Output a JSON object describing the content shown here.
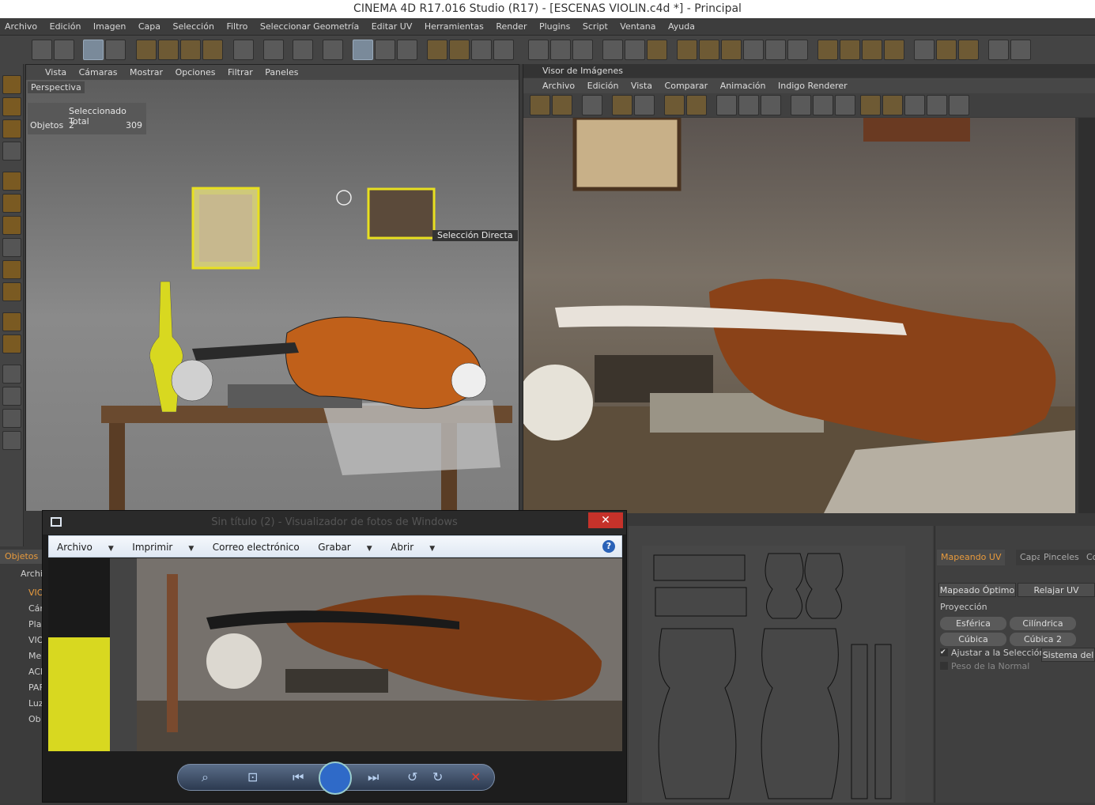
{
  "window": {
    "title": "CINEMA 4D R17.016 Studio (R17) - [ESCENAS VIOLIN.c4d *] - Principal"
  },
  "menu": [
    "Archivo",
    "Edición",
    "Imagen",
    "Capa",
    "Selección",
    "Filtro",
    "Seleccionar Geometría",
    "Editar UV",
    "Herramientas",
    "Render",
    "Plugins",
    "Script",
    "Ventana",
    "Ayuda"
  ],
  "viewport": {
    "menu": [
      "Vista",
      "Cámaras",
      "Mostrar",
      "Opciones",
      "Filtrar",
      "Paneles"
    ],
    "label": "Perspectiva",
    "stats": {
      "col_selected": "Seleccionado Total",
      "row_label": "Objetos",
      "selected": "2",
      "total": "309"
    },
    "tool_label": "Selección Directa"
  },
  "render_viewer": {
    "title": "Visor de Imágenes",
    "menu": [
      "Archivo",
      "Edición",
      "Vista",
      "Comparar",
      "Animación",
      "Indigo Renderer"
    ]
  },
  "objects_panel": {
    "title": "Objetos",
    "menu": "Archi",
    "items": [
      "VIO",
      "Cár",
      "Pla",
      "VIO",
      "Me",
      "ACI",
      "PAF",
      "Luz",
      "Ob"
    ]
  },
  "photo_viewer": {
    "title": "Sin título (2) - Visualizador de fotos de Windows",
    "close": "✕",
    "menu": [
      "Archivo",
      "Imprimir",
      "Correo electrónico",
      "Grabar",
      "Abrir"
    ],
    "help": "?"
  },
  "uv_panel": {
    "tabs": [
      "Mapeando UV",
      "Capas",
      "Pinceles",
      "Co"
    ],
    "buttons": [
      "Mapeado Óptimo",
      "Relajar UV"
    ],
    "section": "Proyección",
    "projections": [
      "Esférica",
      "Cilíndrica",
      "Cúbica",
      "Cúbica 2"
    ],
    "check1": "Ajustar a la Selección",
    "check2": "Peso de la Normal",
    "system_btn": "Sistema del"
  },
  "colors": {
    "accent": "#e89a3c",
    "close": "#c6322a"
  }
}
